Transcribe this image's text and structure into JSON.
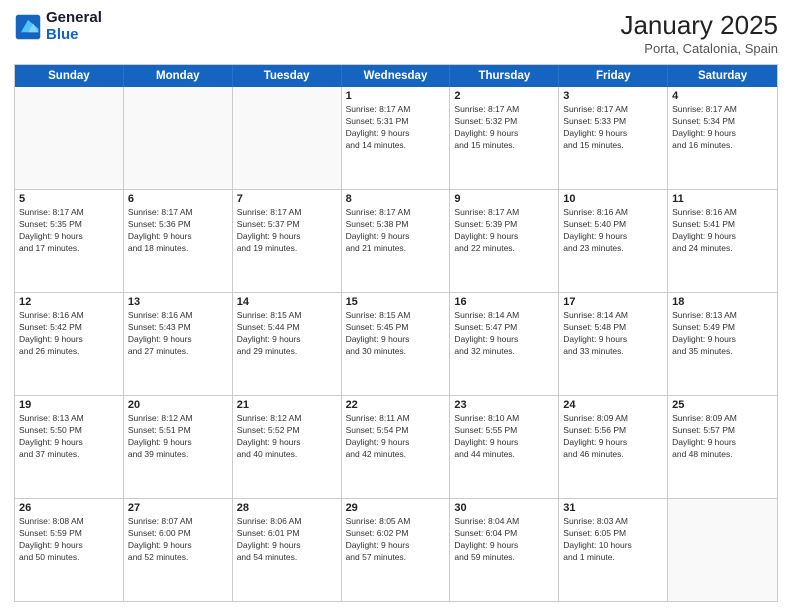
{
  "logo": {
    "line1": "General",
    "line2": "Blue"
  },
  "title": "January 2025",
  "subtitle": "Porta, Catalonia, Spain",
  "days": [
    "Sunday",
    "Monday",
    "Tuesday",
    "Wednesday",
    "Thursday",
    "Friday",
    "Saturday"
  ],
  "weeks": [
    [
      {
        "day": "",
        "info": ""
      },
      {
        "day": "",
        "info": ""
      },
      {
        "day": "",
        "info": ""
      },
      {
        "day": "1",
        "info": "Sunrise: 8:17 AM\nSunset: 5:31 PM\nDaylight: 9 hours\nand 14 minutes."
      },
      {
        "day": "2",
        "info": "Sunrise: 8:17 AM\nSunset: 5:32 PM\nDaylight: 9 hours\nand 15 minutes."
      },
      {
        "day": "3",
        "info": "Sunrise: 8:17 AM\nSunset: 5:33 PM\nDaylight: 9 hours\nand 15 minutes."
      },
      {
        "day": "4",
        "info": "Sunrise: 8:17 AM\nSunset: 5:34 PM\nDaylight: 9 hours\nand 16 minutes."
      }
    ],
    [
      {
        "day": "5",
        "info": "Sunrise: 8:17 AM\nSunset: 5:35 PM\nDaylight: 9 hours\nand 17 minutes."
      },
      {
        "day": "6",
        "info": "Sunrise: 8:17 AM\nSunset: 5:36 PM\nDaylight: 9 hours\nand 18 minutes."
      },
      {
        "day": "7",
        "info": "Sunrise: 8:17 AM\nSunset: 5:37 PM\nDaylight: 9 hours\nand 19 minutes."
      },
      {
        "day": "8",
        "info": "Sunrise: 8:17 AM\nSunset: 5:38 PM\nDaylight: 9 hours\nand 21 minutes."
      },
      {
        "day": "9",
        "info": "Sunrise: 8:17 AM\nSunset: 5:39 PM\nDaylight: 9 hours\nand 22 minutes."
      },
      {
        "day": "10",
        "info": "Sunrise: 8:16 AM\nSunset: 5:40 PM\nDaylight: 9 hours\nand 23 minutes."
      },
      {
        "day": "11",
        "info": "Sunrise: 8:16 AM\nSunset: 5:41 PM\nDaylight: 9 hours\nand 24 minutes."
      }
    ],
    [
      {
        "day": "12",
        "info": "Sunrise: 8:16 AM\nSunset: 5:42 PM\nDaylight: 9 hours\nand 26 minutes."
      },
      {
        "day": "13",
        "info": "Sunrise: 8:16 AM\nSunset: 5:43 PM\nDaylight: 9 hours\nand 27 minutes."
      },
      {
        "day": "14",
        "info": "Sunrise: 8:15 AM\nSunset: 5:44 PM\nDaylight: 9 hours\nand 29 minutes."
      },
      {
        "day": "15",
        "info": "Sunrise: 8:15 AM\nSunset: 5:45 PM\nDaylight: 9 hours\nand 30 minutes."
      },
      {
        "day": "16",
        "info": "Sunrise: 8:14 AM\nSunset: 5:47 PM\nDaylight: 9 hours\nand 32 minutes."
      },
      {
        "day": "17",
        "info": "Sunrise: 8:14 AM\nSunset: 5:48 PM\nDaylight: 9 hours\nand 33 minutes."
      },
      {
        "day": "18",
        "info": "Sunrise: 8:13 AM\nSunset: 5:49 PM\nDaylight: 9 hours\nand 35 minutes."
      }
    ],
    [
      {
        "day": "19",
        "info": "Sunrise: 8:13 AM\nSunset: 5:50 PM\nDaylight: 9 hours\nand 37 minutes."
      },
      {
        "day": "20",
        "info": "Sunrise: 8:12 AM\nSunset: 5:51 PM\nDaylight: 9 hours\nand 39 minutes."
      },
      {
        "day": "21",
        "info": "Sunrise: 8:12 AM\nSunset: 5:52 PM\nDaylight: 9 hours\nand 40 minutes."
      },
      {
        "day": "22",
        "info": "Sunrise: 8:11 AM\nSunset: 5:54 PM\nDaylight: 9 hours\nand 42 minutes."
      },
      {
        "day": "23",
        "info": "Sunrise: 8:10 AM\nSunset: 5:55 PM\nDaylight: 9 hours\nand 44 minutes."
      },
      {
        "day": "24",
        "info": "Sunrise: 8:09 AM\nSunset: 5:56 PM\nDaylight: 9 hours\nand 46 minutes."
      },
      {
        "day": "25",
        "info": "Sunrise: 8:09 AM\nSunset: 5:57 PM\nDaylight: 9 hours\nand 48 minutes."
      }
    ],
    [
      {
        "day": "26",
        "info": "Sunrise: 8:08 AM\nSunset: 5:59 PM\nDaylight: 9 hours\nand 50 minutes."
      },
      {
        "day": "27",
        "info": "Sunrise: 8:07 AM\nSunset: 6:00 PM\nDaylight: 9 hours\nand 52 minutes."
      },
      {
        "day": "28",
        "info": "Sunrise: 8:06 AM\nSunset: 6:01 PM\nDaylight: 9 hours\nand 54 minutes."
      },
      {
        "day": "29",
        "info": "Sunrise: 8:05 AM\nSunset: 6:02 PM\nDaylight: 9 hours\nand 57 minutes."
      },
      {
        "day": "30",
        "info": "Sunrise: 8:04 AM\nSunset: 6:04 PM\nDaylight: 9 hours\nand 59 minutes."
      },
      {
        "day": "31",
        "info": "Sunrise: 8:03 AM\nSunset: 6:05 PM\nDaylight: 10 hours\nand 1 minute."
      },
      {
        "day": "",
        "info": ""
      }
    ]
  ]
}
